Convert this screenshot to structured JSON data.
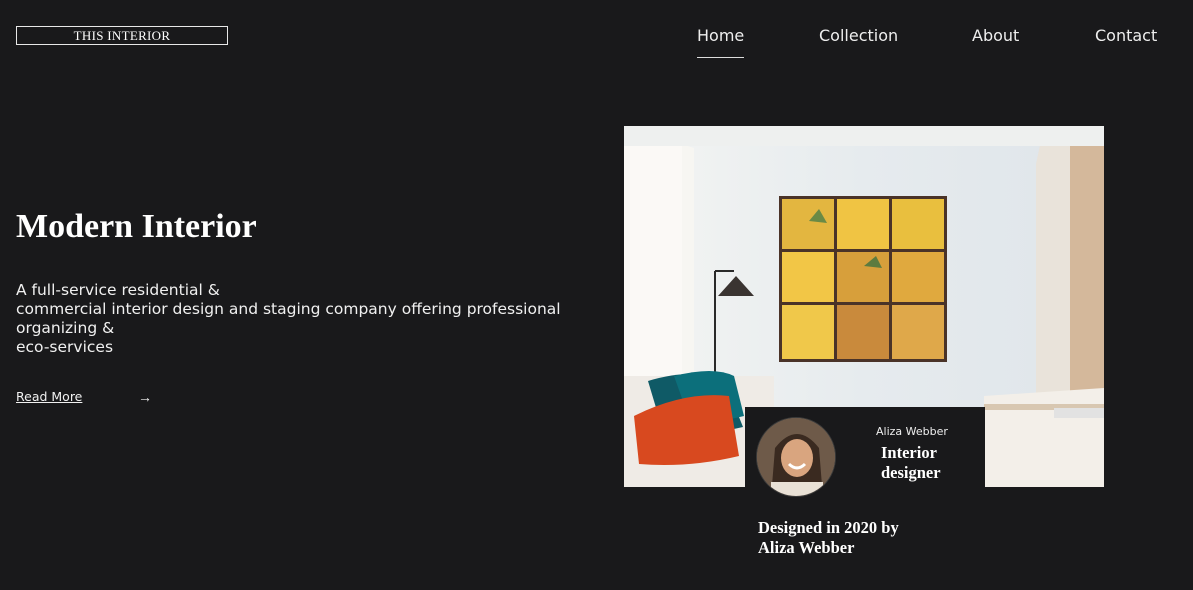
{
  "header": {
    "logo": "THIS INTERIOR",
    "nav": [
      {
        "label": "Home",
        "active": true
      },
      {
        "label": "Collection",
        "active": false
      },
      {
        "label": "About",
        "active": false
      },
      {
        "label": "Contact",
        "active": false
      }
    ]
  },
  "hero": {
    "title": "Modern Interior",
    "description_lines": [
      "A full-service residential &",
      "commercial interior design and staging company offering professional",
      "organizing &",
      "eco-services"
    ],
    "read_more": "Read More",
    "arrow_icon": "arrow-right-icon"
  },
  "designer_card": {
    "name": "Aliza Webber",
    "role": "Interior designer"
  },
  "caption": "Designed in 2020 by Aliza Webber",
  "colors": {
    "background": "#19191b",
    "text": "#ffffff"
  }
}
